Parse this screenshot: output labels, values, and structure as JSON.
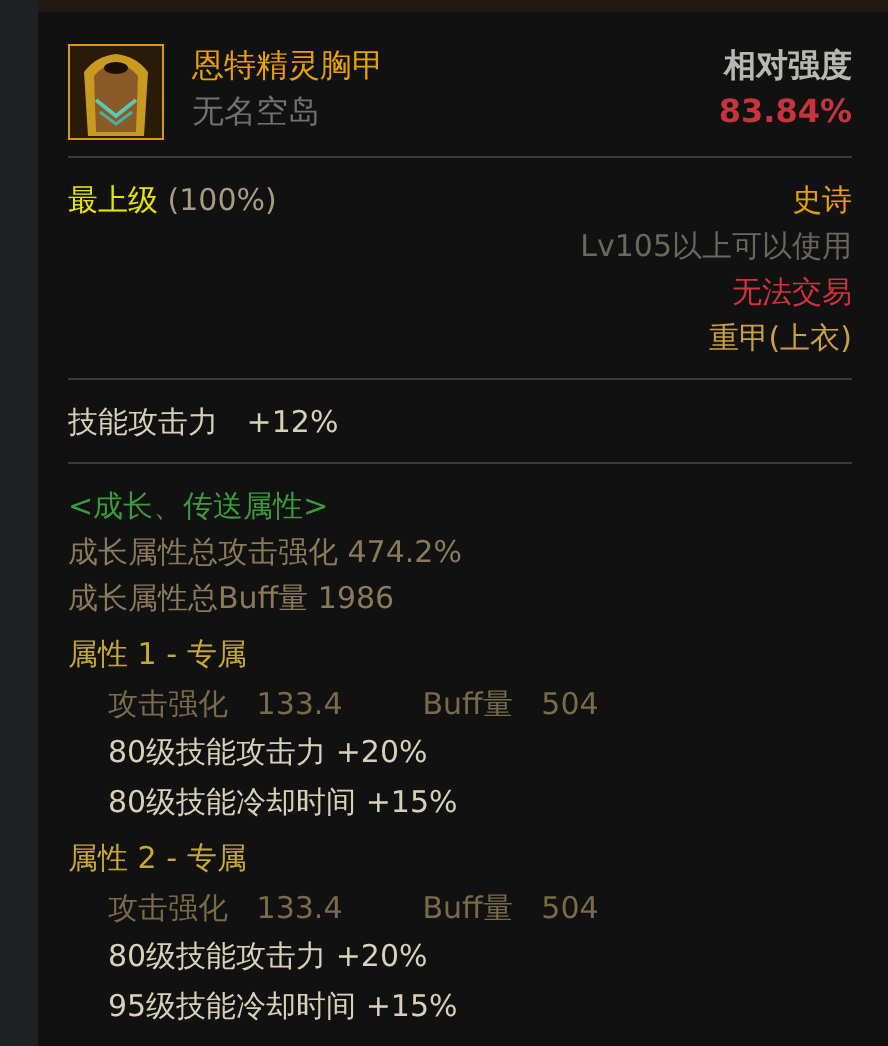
{
  "item": {
    "name": "恩特精灵胸甲",
    "subtitle": "无名空岛",
    "strength_label": "相对强度",
    "strength_value": "83.84%"
  },
  "grade": {
    "label": "最上级",
    "percent": "(100%)",
    "rarity": "史诗"
  },
  "requirement": "Lv105以上可以使用",
  "trade": "无法交易",
  "slot": "重甲(上衣)",
  "basic_stats": [
    {
      "label": "技能攻击力",
      "value": "+12%"
    }
  ],
  "growth": {
    "title": "<成长、传送属性>",
    "lines": [
      "成长属性总攻击强化 474.2%",
      "成长属性总Buff量 1986"
    ]
  },
  "attributes": [
    {
      "title": "属性 1 - 专属",
      "stats": [
        {
          "label": "攻击强化",
          "value": "133.4"
        },
        {
          "label": "Buff量",
          "value": "504"
        }
      ],
      "effects": [
        "80级技能攻击力 +20%",
        "80级技能冷却时间 +15%"
      ]
    },
    {
      "title": "属性 2 - 专属",
      "stats": [
        {
          "label": "攻击强化",
          "value": "133.4"
        },
        {
          "label": "Buff量",
          "value": "504"
        }
      ],
      "effects": [
        "80级技能攻击力 +20%",
        "95级技能冷却时间 +15%"
      ]
    }
  ]
}
